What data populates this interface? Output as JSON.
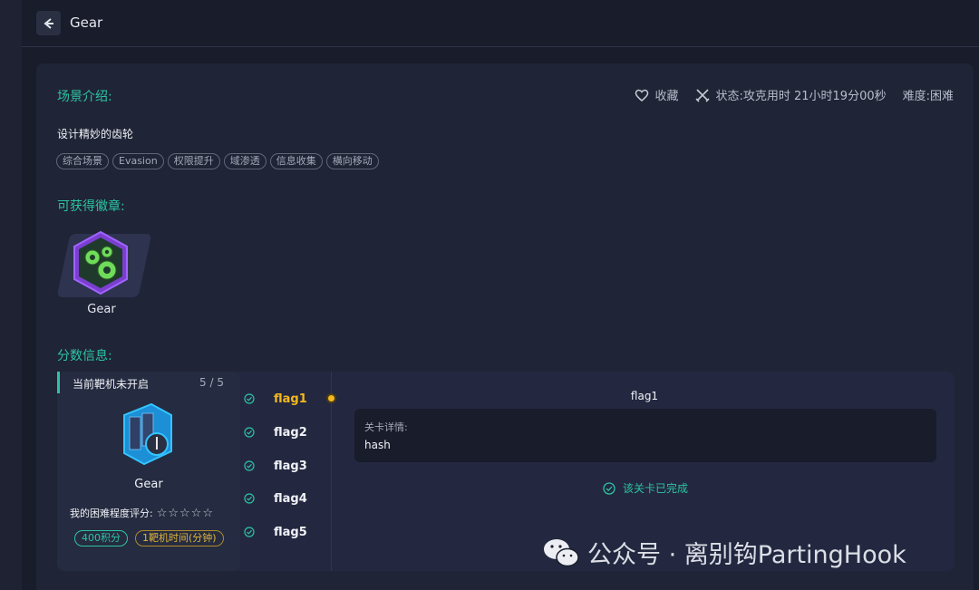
{
  "header": {
    "title": "Gear"
  },
  "scene": {
    "section_title": "场景介绍:",
    "favorite_label": "收藏",
    "status_label": "状态:攻克用时 21小时19分00秒",
    "difficulty_label": "难度:困难",
    "description": "设计精妙的齿轮",
    "tags": [
      "综合场景",
      "Evasion",
      "权限提升",
      "域渗透",
      "信息收集",
      "横向移动"
    ]
  },
  "badges": {
    "section_title": "可获得徽章:",
    "items": [
      {
        "label": "Gear"
      }
    ]
  },
  "score": {
    "section_title": "分数信息:",
    "target": {
      "status": "当前靶机未开启",
      "count": "5 / 5",
      "name": "Gear",
      "rating_label": "我的困难程度评分:",
      "stars": "☆☆☆☆☆",
      "points": "400积分",
      "time": "1靶机时间(分钟)"
    },
    "flags": [
      "flag1",
      "flag2",
      "flag3",
      "flag4",
      "flag5"
    ],
    "active_flag": "flag1",
    "detail": {
      "title": "flag1",
      "label": "关卡详情:",
      "value": "hash",
      "done_text": "该关卡已完成"
    }
  },
  "watermark": {
    "text": "公众号 · 离别钩PartingHook"
  },
  "colors": {
    "accent": "#2dc3a3",
    "active": "#f4b81e",
    "background": "#181c2b"
  }
}
